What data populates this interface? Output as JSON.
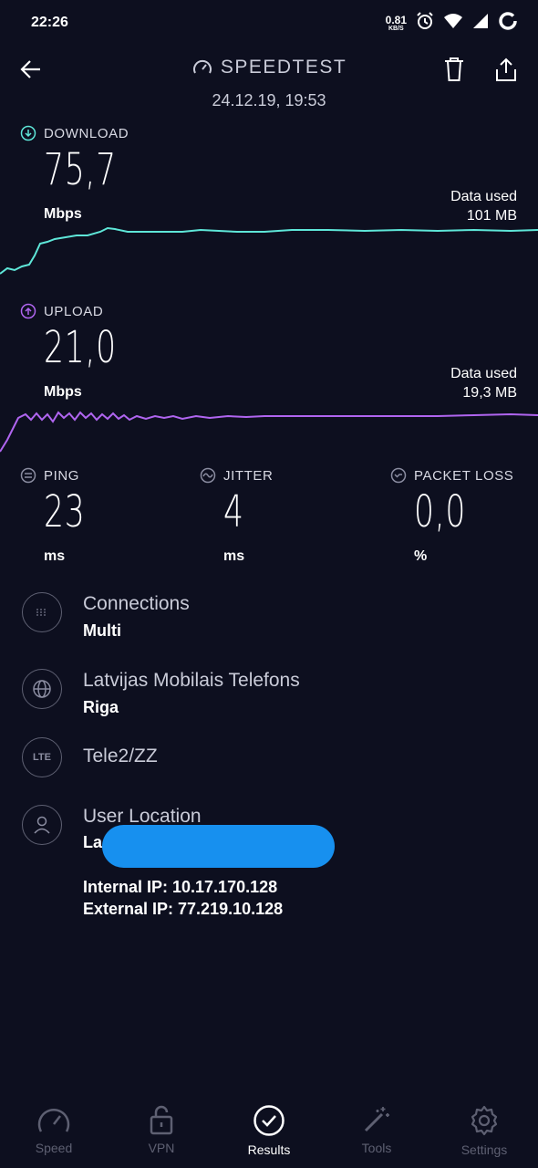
{
  "status_bar": {
    "time": "22:26",
    "net_speed_value": "0.81",
    "net_speed_unit": "KB/S",
    "icons": [
      "alarm-icon",
      "wifi-icon",
      "signal-icon",
      "battery-ring-icon"
    ]
  },
  "header": {
    "title": "SPEEDTEST",
    "datetime": "24.12.19, 19:53"
  },
  "download": {
    "label": "DOWNLOAD",
    "value": "75,7",
    "unit": "Mbps",
    "data_used_label": "Data used",
    "data_used_value": "101 MB",
    "color": "#5ee6d8"
  },
  "upload": {
    "label": "UPLOAD",
    "value": "21,0",
    "unit": "Mbps",
    "data_used_label": "Data used",
    "data_used_value": "19,3 MB",
    "color": "#b065f0"
  },
  "metrics": {
    "ping": {
      "label": "PING",
      "value": "23",
      "unit": "ms"
    },
    "jitter": {
      "label": "JITTER",
      "value": "4",
      "unit": "ms"
    },
    "packet_loss": {
      "label": "PACKET LOSS",
      "value": "0,0",
      "unit": "%"
    }
  },
  "info": {
    "connections": {
      "title": "Connections",
      "value": "Multi"
    },
    "provider": {
      "title": "Latvijas Mobilais Telefons",
      "value": "Riga"
    },
    "network": {
      "badge": "LTE",
      "title": "Tele2/ZZ"
    },
    "user_location": {
      "title": "User Location",
      "value_prefix": "La"
    },
    "internal_ip": "Internal IP: 10.17.170.128",
    "external_ip": "External IP: 77.219.10.128"
  },
  "nav": {
    "items": [
      {
        "label": "Speed",
        "icon": "speedometer-icon"
      },
      {
        "label": "VPN",
        "icon": "lock-icon"
      },
      {
        "label": "Results",
        "icon": "check-circle-icon"
      },
      {
        "label": "Tools",
        "icon": "magic-wand-icon"
      },
      {
        "label": "Settings",
        "icon": "gear-icon"
      }
    ],
    "active": "Results"
  }
}
